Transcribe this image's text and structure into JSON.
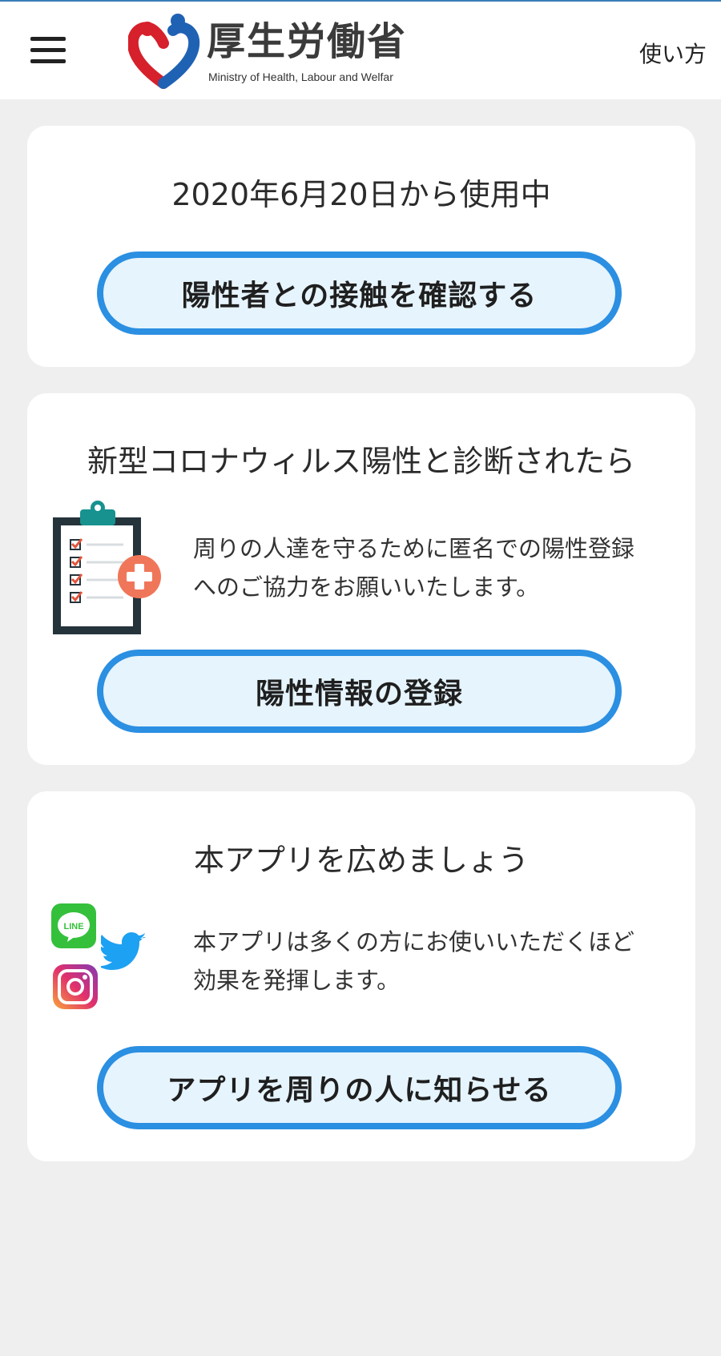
{
  "header": {
    "logo_title": "厚生労働省",
    "logo_subtitle": "Ministry of Health, Labour and Welfar",
    "howto_label": "使い方"
  },
  "card_contact": {
    "usage_text": "2020年6月20日から使用中",
    "button_label": "陽性者との接触を確認する"
  },
  "card_positive": {
    "heading": "新型コロナウィルス陽性と診断されたら",
    "desc_line1": "周りの人達を守るために匿名での陽性登録",
    "desc_line2": "へのご協力をお願いいたします。",
    "button_label": "陽性情報の登録"
  },
  "card_share": {
    "heading": "本アプリを広めましょう",
    "desc_line1": "本アプリは多くの方にお使いいただくほど",
    "desc_line2": "効果を発揮します。",
    "button_label": "アプリを周りの人に知らせる",
    "line_icon_text": "LINE"
  },
  "colors": {
    "accent": "#2b8fe2",
    "button_fill": "#e6f4fd",
    "background": "#efefef"
  }
}
